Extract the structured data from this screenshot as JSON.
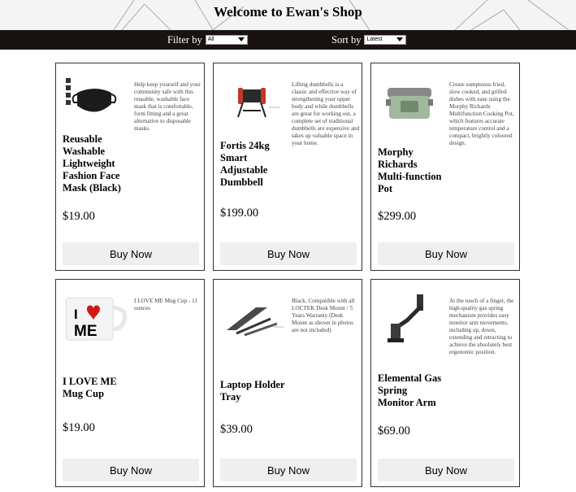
{
  "shop": {
    "title": "Welcome to Ewan's Shop"
  },
  "filter": {
    "label": "Filter by",
    "selected": "All"
  },
  "sort": {
    "label": "Sort by",
    "selected": "Latest"
  },
  "products": [
    {
      "name": "Reusable Washable Lightweight Fashion Face Mask (Black)",
      "description": "Help keep yourself and your community safe with this reusable, washable face mask that is comfortable, form fitting and a great alternative to disposable masks.",
      "price": "$19.00",
      "button": "Buy Now",
      "image_icon": "face-mask-icon"
    },
    {
      "name": "Fortis 24kg Smart Adjustable Dumbbell",
      "description": "Lifting dumbbells is a classic and effective way of strengthening your upper body and while dumbbells are great for working out, a complete set of traditional dumbbells are expensive and takes up valuable space in your home.",
      "price": "$199.00",
      "button": "Buy Now",
      "image_icon": "dumbbell-icon"
    },
    {
      "name": "Morphy Richards Multi-function Pot",
      "description": "Create sumptuous fried, slow cooked, and grilled dishes with ease using the Morphy Richards Multifunction Cooking Pot, which features accurate temperature control and a compact, brightly coloured design.",
      "price": "$299.00",
      "button": "Buy Now",
      "image_icon": "cooking-pot-icon"
    },
    {
      "name": "I LOVE ME Mug Cup",
      "description": "I LOVE ME Mug Cup - 11 ounces",
      "price": "$19.00",
      "button": "Buy Now",
      "image_icon": "mug-icon",
      "image_text": "I ME"
    },
    {
      "name": "Laptop Holder Tray",
      "description": "Black, Compatible with all LOCTEK Desk Mount / 5 Years Warranty (Desk Mount as shown in photos are not included)",
      "price": "$39.00",
      "button": "Buy Now",
      "image_icon": "laptop-stand-icon"
    },
    {
      "name": "Elemental Gas Spring Monitor Arm",
      "description": "At the touch of a finger, the high-quality gas spring mechanism provides easy monitor arm movements, including up, down, extending and retracting to achieve the absolutely best ergonomic position.",
      "price": "$69.00",
      "button": "Buy Now",
      "image_icon": "monitor-arm-icon"
    }
  ]
}
